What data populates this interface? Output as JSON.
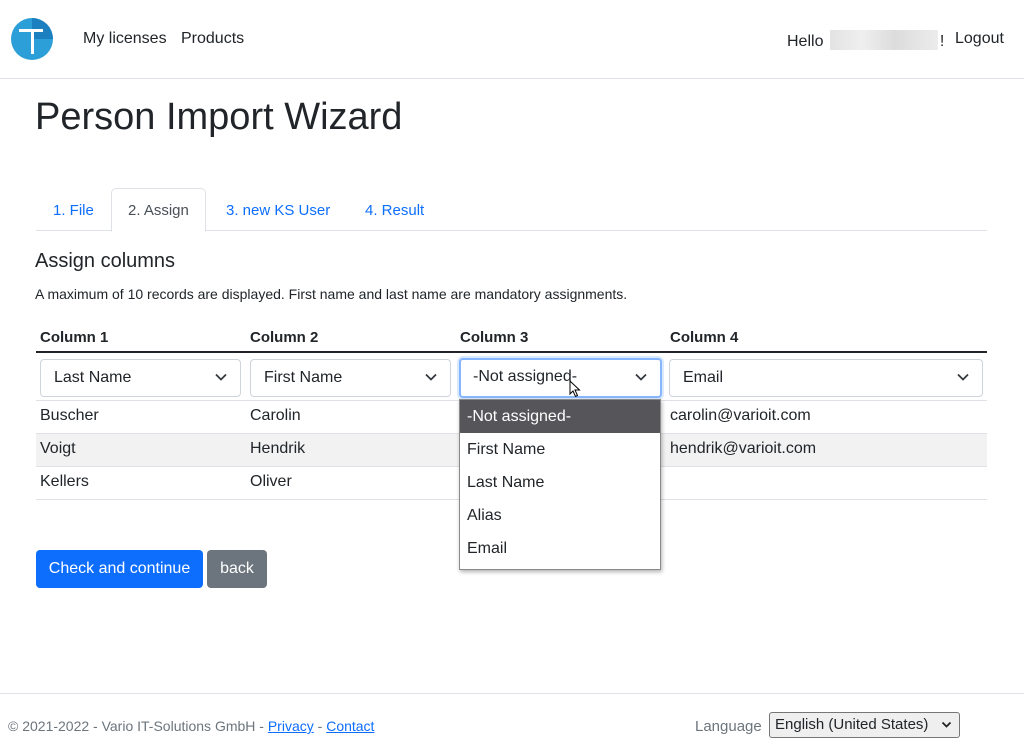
{
  "navbar": {
    "links": [
      "My licenses",
      "Products"
    ],
    "greeting_prefix": "Hello",
    "greeting_suffix": "!",
    "logout": "Logout"
  },
  "page": {
    "title": "Person Import Wizard",
    "tabs": [
      "1. File",
      "2. Assign",
      "3. new KS User",
      "4. Result"
    ],
    "active_tab": "2. Assign",
    "section_title": "Assign columns",
    "hint": "A maximum of 10 records are displayed. First name and last name are mandatory assignments."
  },
  "table": {
    "headers": [
      "Column 1",
      "Column 2",
      "Column 3",
      "Column 4"
    ],
    "assignments": [
      "Last Name",
      "First Name",
      "-Not assigned-",
      "Email"
    ],
    "rows": [
      [
        "Buscher",
        "Carolin",
        "",
        "carolin@varioit.com"
      ],
      [
        "Voigt",
        "Hendrik",
        "",
        "hendrik@varioit.com"
      ],
      [
        "Kellers",
        "Oliver",
        "",
        ""
      ]
    ]
  },
  "dropdown": {
    "options": [
      "-Not assigned-",
      "First Name",
      "Last Name",
      "Alias",
      "Email"
    ],
    "selected": "-Not assigned-"
  },
  "buttons": {
    "primary": "Check and continue",
    "secondary": "back"
  },
  "footer": {
    "copyright": "© 2021-2022 - Vario IT-Solutions GmbH - ",
    "privacy": "Privacy",
    "separator": " - ",
    "contact": "Contact",
    "language_label": "Language",
    "language_value": "English (United States)"
  },
  "colors": {
    "primary": "#0d6efd",
    "secondary": "#6c757d",
    "logo": "#2d9fd8"
  }
}
